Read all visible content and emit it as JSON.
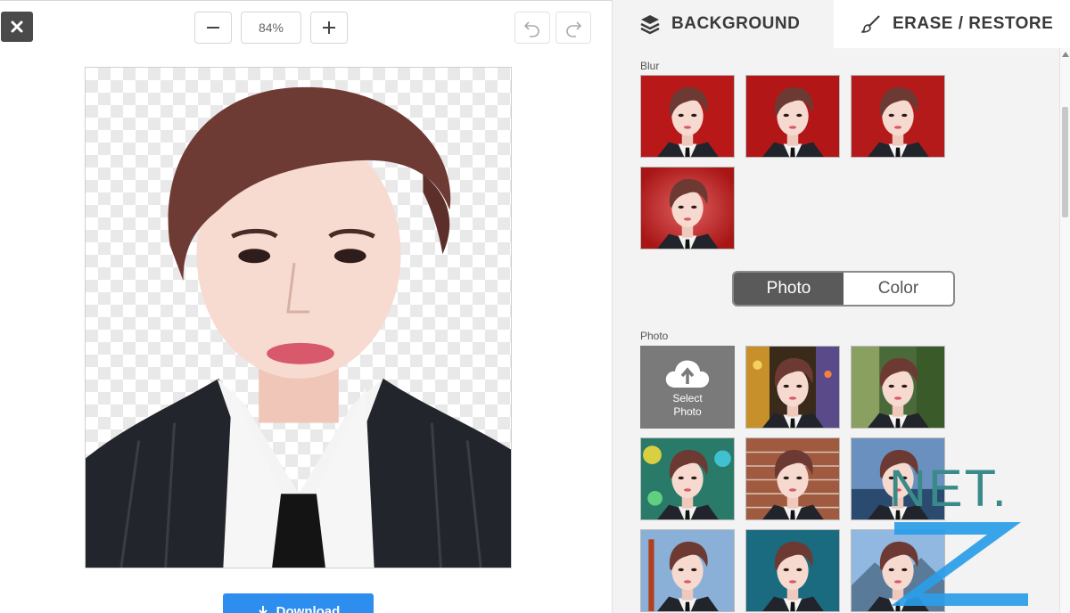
{
  "toolbar": {
    "close_icon": "close-x-icon",
    "zoom_out_icon": "minus-icon",
    "zoom_level": "84%",
    "zoom_in_icon": "plus-icon",
    "undo_icon": "undo-icon",
    "redo_icon": "redo-icon"
  },
  "editor": {
    "download_label": "Download"
  },
  "panel": {
    "tabs": [
      {
        "label": "BACKGROUND",
        "icon": "layers-icon",
        "active": true
      },
      {
        "label": "ERASE / RESTORE",
        "icon": "brush-icon",
        "active": false
      }
    ],
    "blur_label": "Blur",
    "toggle": {
      "photo_label": "Photo",
      "color_label": "Color",
      "selected": "Photo"
    },
    "photo_label": "Photo",
    "select_photo": {
      "line1": "Select",
      "line2": "Photo",
      "icon": "cloud-upload-icon"
    }
  },
  "watermark": {
    "text": "NET.",
    "letter": "Z"
  },
  "colors": {
    "accent_blue": "#2e8ef0",
    "toggle_active": "#5a5a5a",
    "blur_red": "#b81818",
    "watermark_teal": "#3a8a8a",
    "watermark_blue": "#2a9de8"
  }
}
